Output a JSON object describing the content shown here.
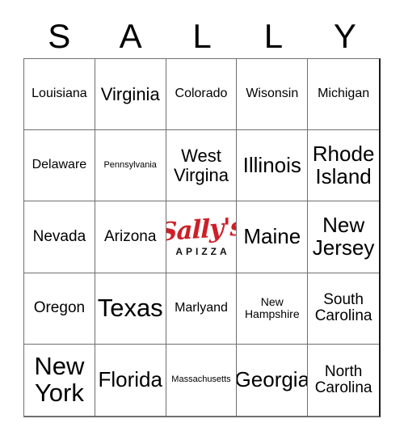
{
  "header": {
    "letters": [
      "S",
      "A",
      "L",
      "L",
      "Y"
    ]
  },
  "colors": {
    "logo_red": "#CC2028",
    "grid_line": "#6f6f6f",
    "text": "#000000",
    "background": "#ffffff"
  },
  "free_space": {
    "brand_script": "Sally's",
    "brand_sub": "APIZZA"
  },
  "grid": {
    "columns": 5,
    "rows": 5,
    "cells": [
      {
        "text": "Louisiana",
        "size": "fs-md",
        "type": "text"
      },
      {
        "text": "Virginia",
        "size": "fs-xl",
        "type": "text"
      },
      {
        "text": "Colorado",
        "size": "fs-md",
        "type": "text"
      },
      {
        "text": "Wisonsin",
        "size": "fs-md",
        "type": "text"
      },
      {
        "text": "Michigan",
        "size": "fs-md",
        "type": "text"
      },
      {
        "text": "Delaware",
        "size": "fs-md",
        "type": "text"
      },
      {
        "text": "Pennsylvania",
        "size": "fs-xs",
        "type": "text"
      },
      {
        "text": "West\nVirgina",
        "size": "fs-xl",
        "type": "text"
      },
      {
        "text": "Illinois",
        "size": "fs-xxl",
        "type": "text"
      },
      {
        "text": "Rhode\nIsland",
        "size": "fs-xxl",
        "type": "text"
      },
      {
        "text": "Nevada",
        "size": "fs-lg",
        "type": "text"
      },
      {
        "text": "Arizona",
        "size": "fs-lg",
        "type": "text"
      },
      {
        "text": "Sally's APIZZA",
        "size": "fs-md",
        "type": "logo"
      },
      {
        "text": "Maine",
        "size": "fs-xxl",
        "type": "text"
      },
      {
        "text": "New\nJersey",
        "size": "fs-xxl",
        "type": "text"
      },
      {
        "text": "Oregon",
        "size": "fs-lg",
        "type": "text"
      },
      {
        "text": "Texas",
        "size": "fs-huge",
        "type": "text"
      },
      {
        "text": "Marlyand",
        "size": "fs-md",
        "type": "text"
      },
      {
        "text": "New\nHampshire",
        "size": "fs-sm",
        "type": "text"
      },
      {
        "text": "South\nCarolina",
        "size": "fs-lg",
        "type": "text"
      },
      {
        "text": "New\nYork",
        "size": "fs-huge",
        "type": "text"
      },
      {
        "text": "Florida",
        "size": "fs-xxl",
        "type": "text"
      },
      {
        "text": "Massachusetts",
        "size": "fs-xs",
        "type": "text"
      },
      {
        "text": "Georgia",
        "size": "fs-xxl",
        "type": "text"
      },
      {
        "text": "North\nCarolina",
        "size": "fs-lg",
        "type": "text"
      }
    ]
  }
}
